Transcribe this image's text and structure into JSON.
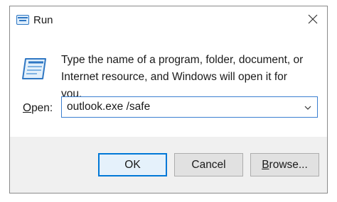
{
  "window": {
    "title": "Run",
    "icon": "run-app-icon",
    "close_icon": "close-icon"
  },
  "description": {
    "line1": "Type the name of a program, folder, document, or",
    "line2": "Internet resource, and Windows will open it for you."
  },
  "open_field": {
    "label_accesskey": "O",
    "label_rest": "pen:",
    "value": "outlook.exe /safe",
    "dropdown_icon": "chevron-down-icon"
  },
  "buttons": {
    "ok": "OK",
    "cancel": "Cancel",
    "browse_accesskey": "B",
    "browse_rest": "rowse..."
  },
  "colors": {
    "focus_border": "#3b7fd0",
    "default_button_border": "#0078d7",
    "footer_bg": "#f0f0f0"
  }
}
